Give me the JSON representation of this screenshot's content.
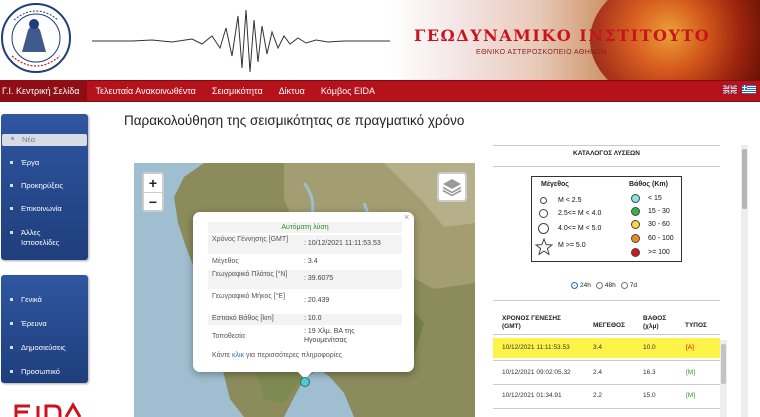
{
  "header": {
    "logo_name": "National Observatory of Athens seal",
    "title": "ΓΕΩΔΥΝΑΜΙΚΟ ΙΝΣΤΙΤΟΥΤΟ",
    "subtitle": "ΕΘΝΙΚΟ ΑΣΤΕΡΟΣΚΟΠΕΙΟ ΑΘΗΝΩΝ"
  },
  "topnav": {
    "items": [
      "Γ.Ι. Κεντρική Σελίδα",
      "Τελευταία Ανακοινωθέντα",
      "Σεισμικότητα",
      "Δίκτυα",
      "Κόμβος EIDA"
    ],
    "flags": [
      "uk-flag-icon",
      "greek-flag-icon"
    ]
  },
  "sidebar": {
    "group1": [
      "Νέα",
      "Έργα",
      "Προκηρύξεις",
      "Επικοινωνία",
      "Άλλες Ιστοσελίδες"
    ],
    "group2": [
      "Γενικά",
      "Έρευνα",
      "Δημοσιεύσεις",
      "Προσωπικό"
    ]
  },
  "main": {
    "page_title": "Παρακολούθηση της σεισμικότητας σε πραγματικό χρόνο",
    "map": {
      "zoom_in": "+",
      "zoom_out": "−",
      "popup": {
        "title": "Αυτόματη λύση",
        "rows": [
          {
            "k": "Χρόνος Γέννησης [GMT]",
            "v": ": 10/12/2021 11:11:53.53"
          },
          {
            "k": "Μέγεθος",
            "v": ": 3.4"
          },
          {
            "k": "Γεωγραφικό Πλάτος [°N]",
            "v": ": 39.6075"
          },
          {
            "k": "Γεωγραφικό Μήκος [°E]",
            "v": ": 20.439"
          },
          {
            "k": "Εστιακό Βάθος [km]",
            "v": ": 10.0"
          },
          {
            "k": "Τοποθεσία",
            "v": ": 19 Χλμ. ΒΑ της Ηγουμενίτσας"
          }
        ],
        "more_prefix": "Κάντε ",
        "more_link": "κλικ",
        "more_suffix": " για περισσότερες πληροφορίες"
      }
    }
  },
  "catalog": {
    "title": "ΚΑΤΑΛΟΓΟΣ ΛΥΣΕΩΝ",
    "legend": {
      "mag_head": "Μέγεθος",
      "depth_head": "Βάθος (Km)",
      "mags": [
        "M < 2.5",
        "2.5<= M < 4.0",
        "4.0<= M < 5.0",
        "M >= 5.0"
      ],
      "depths": [
        "< 15",
        "15 - 30",
        "30 - 60",
        "60 - 100",
        ">= 100"
      ],
      "depth_colors": [
        "#7fe8e2",
        "#37b04a",
        "#ffd43a",
        "#f08a1e",
        "#d0161c"
      ]
    },
    "filters": [
      {
        "label": "24h",
        "selected": true
      },
      {
        "label": "48h",
        "selected": false
      },
      {
        "label": "7d",
        "selected": false
      }
    ],
    "headers": {
      "time": "ΧΡΟΝΟΣ ΓΕΝΕΣΗΣ (GMT)",
      "mag": "ΜΕΓΕΘΟΣ",
      "depth": "ΒΑΘΟΣ (χλμ)",
      "type": "ΤΥΠΟΣ"
    },
    "rows": [
      {
        "time": "10/12/2021 11:11:53.53",
        "mag": "3.4",
        "depth": "10.0",
        "type": "[A]"
      },
      {
        "time": "10/12/2021 09:02:05.32",
        "mag": "2.4",
        "depth": "16.3",
        "type": "[M]"
      },
      {
        "time": "10/12/2021 01:34.91",
        "mag": "2.2",
        "depth": "15.0",
        "type": "[M]"
      }
    ]
  }
}
